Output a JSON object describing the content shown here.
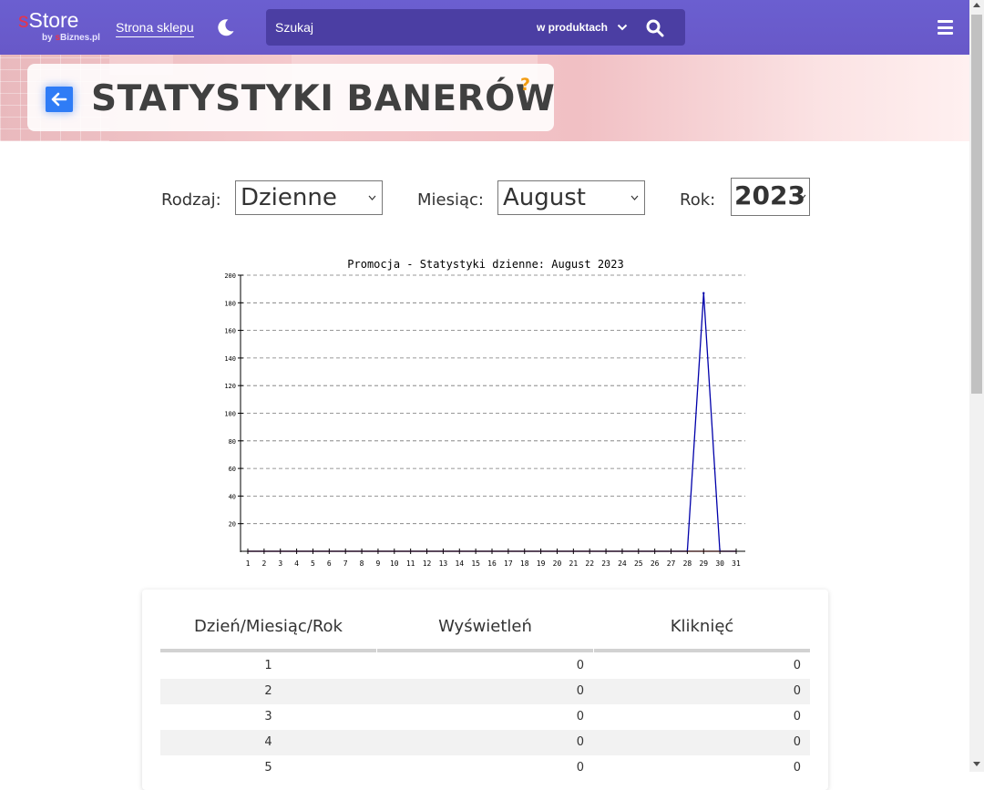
{
  "header": {
    "brand_prefix": "s",
    "brand_name": "Store",
    "by_text": "by",
    "by_brand_prefix": "s",
    "by_brand_name": "Biznes.pl",
    "shop_link": "Strona sklepu",
    "search_placeholder": "Szukaj",
    "search_scope": "w produktach",
    "colors": {
      "bar": "#6a5acd",
      "search_bg": "#4b3ea3",
      "brand_accent": "#e8344a"
    }
  },
  "page": {
    "title": "STATYSTYKI BANERÓW",
    "help": "?"
  },
  "filters": {
    "type_label": "Rodzaj:",
    "type_value": "Dzienne",
    "month_label": "Miesiąc:",
    "month_value": "August",
    "year_label": "Rok:",
    "year_value": "2023"
  },
  "chart_data": {
    "type": "line",
    "title": "Promocja - Statystyki dzienne:  August 2023",
    "x": [
      1,
      2,
      3,
      4,
      5,
      6,
      7,
      8,
      9,
      10,
      11,
      12,
      13,
      14,
      15,
      16,
      17,
      18,
      19,
      20,
      21,
      22,
      23,
      24,
      25,
      26,
      27,
      28,
      29,
      30,
      31
    ],
    "x_tick_labels": [
      "1",
      "2",
      "3",
      "4",
      "5",
      "6",
      "7",
      "8",
      "9",
      "10",
      "11",
      "12",
      "13",
      "14",
      "15",
      "16",
      "17",
      "18",
      "19",
      "20",
      "21",
      "22",
      "23",
      "24",
      "25",
      "26",
      "27",
      "28",
      "29",
      "30",
      "31"
    ],
    "y_tick_labels": [
      "20",
      "40",
      "60",
      "80",
      "100",
      "120",
      "140",
      "160",
      "180",
      "200"
    ],
    "ylim": [
      0,
      200
    ],
    "grid": true,
    "series": [
      {
        "values": [
          0,
          0,
          0,
          0,
          0,
          0,
          0,
          0,
          0,
          0,
          0,
          0,
          0,
          0,
          0,
          0,
          0,
          0,
          0,
          0,
          0,
          0,
          0,
          0,
          0,
          0,
          0,
          0,
          0,
          0,
          0
        ],
        "color": "#d40000"
      },
      {
        "values": [
          0,
          0,
          0,
          0,
          0,
          0,
          0,
          0,
          0,
          0,
          0,
          0,
          0,
          0,
          0,
          0,
          0,
          0,
          0,
          0,
          0,
          0,
          0,
          0,
          0,
          0,
          0,
          0,
          187,
          0,
          0
        ],
        "color": "#0000aa"
      }
    ]
  },
  "table": {
    "headers": [
      "Dzień/Miesiąc/Rok",
      "Wyświetleń",
      "Kliknięć"
    ],
    "rows": [
      {
        "day": "1",
        "views": "0",
        "clicks": "0"
      },
      {
        "day": "2",
        "views": "0",
        "clicks": "0"
      },
      {
        "day": "3",
        "views": "0",
        "clicks": "0"
      },
      {
        "day": "4",
        "views": "0",
        "clicks": "0"
      },
      {
        "day": "5",
        "views": "0",
        "clicks": "0"
      }
    ]
  }
}
